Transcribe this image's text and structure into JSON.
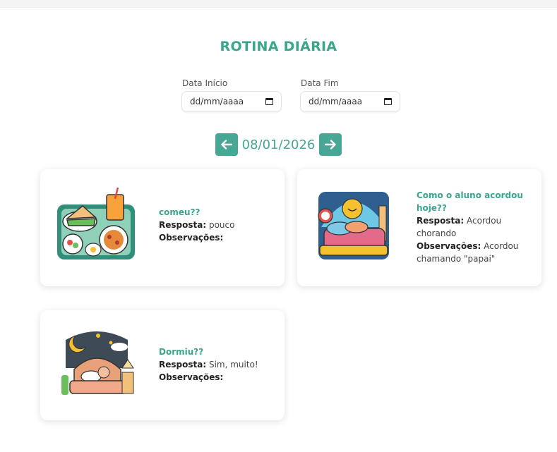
{
  "header": {
    "title": "ROTINA DIÁRIA"
  },
  "filters": {
    "start": {
      "label": "Data Início",
      "placeholder": "dd/mm/aaaa"
    },
    "end": {
      "label": "Data Fim",
      "placeholder": "dd/mm/aaaa"
    }
  },
  "nav": {
    "prev_icon": "arrow-left-icon",
    "current_date": "08/01/2026",
    "next_icon": "arrow-right-icon"
  },
  "labels": {
    "answer": "Resposta:",
    "notes": "Observações:"
  },
  "cards": [
    {
      "question": "comeu??",
      "answer": "pouco",
      "notes": "",
      "icon": "meal-tray-icon"
    },
    {
      "question": "Como o aluno acordou hoje??",
      "answer": "Acordou chorando",
      "notes": "Acordou chamando \"papai\"",
      "icon": "sunrise-bed-icon"
    },
    {
      "question": "Dormiu??",
      "answer": "Sim, muito!",
      "notes": "",
      "icon": "night-bed-icon"
    }
  ],
  "colors": {
    "accent": "#46a794",
    "title": "#3aa68e"
  }
}
